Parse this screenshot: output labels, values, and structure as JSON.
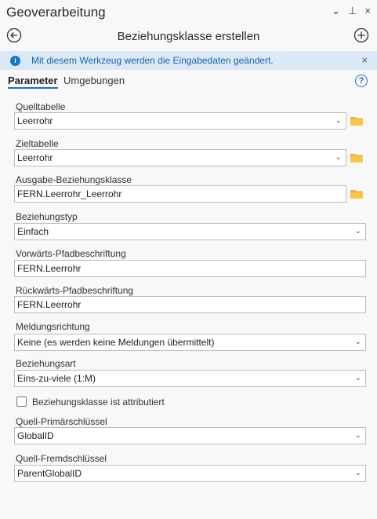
{
  "pane": {
    "title": "Geoverarbeitung",
    "controls": [
      "⌄",
      "⊥",
      "×"
    ]
  },
  "tool": {
    "title": "Beziehungsklasse erstellen"
  },
  "info": {
    "message": "Mit diesem Werkzeug werden die Eingabedaten geändert."
  },
  "tabs": {
    "parameters": "Parameter",
    "environments": "Umgebungen"
  },
  "params": {
    "origin_table": {
      "label": "Quelltabelle",
      "value": "Leerrohr"
    },
    "destination_table": {
      "label": "Zieltabelle",
      "value": "Leerrohr"
    },
    "output_class": {
      "label": "Ausgabe-Beziehungsklasse",
      "value": "FERN.Leerrohr_Leerrohr"
    },
    "relationship_type": {
      "label": "Beziehungstyp",
      "value": "Einfach"
    },
    "forward_label": {
      "label": "Vorwärts-Pfadbeschriftung",
      "value": "FERN.Leerrohr"
    },
    "backward_label": {
      "label": "Rückwärts-Pfadbeschriftung",
      "value": "FERN.Leerrohr"
    },
    "message_direction": {
      "label": "Meldungsrichtung",
      "value": "Keine (es werden keine Meldungen übermittelt)"
    },
    "cardinality": {
      "label": "Beziehungsart",
      "value": "Eins-zu-viele (1:M)"
    },
    "attributed": {
      "label": "Beziehungsklasse ist attributiert",
      "checked": false
    },
    "origin_primary_key": {
      "label": "Quell-Primärschlüssel",
      "value": "GlobalID"
    },
    "origin_foreign_key": {
      "label": "Quell-Fremdschlüssel",
      "value": "ParentGlobalID"
    }
  },
  "colors": {
    "accent": "#1a72c9",
    "info_bg": "#dbe9f6",
    "folder": "#e8b43a"
  }
}
